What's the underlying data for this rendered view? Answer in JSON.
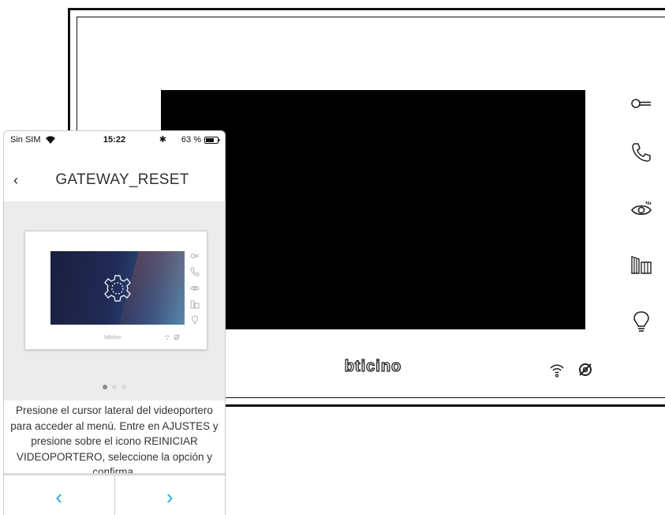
{
  "device": {
    "brand": "bticino",
    "side_buttons": [
      "key-icon",
      "phone-handset-icon",
      "eye-icon",
      "gates-icon",
      "bulb-icon"
    ],
    "status_icons": [
      "wifi-icon",
      "muted-ring-icon"
    ]
  },
  "app": {
    "status_bar": {
      "carrier": "Sin SIM",
      "time": "15:22",
      "bluetooth": "✱",
      "battery": "63 %"
    },
    "header": {
      "back_icon": "‹",
      "title": "GATEWAY_RESET"
    },
    "gallery": {
      "image_icon": "gear-icon",
      "page_count": 3,
      "active_page": 1
    },
    "instructions": "Presione el cursor lateral del videoportero para acceder al menú. Entre en AJUSTES y presione sobre el icono REINICIAR VIDEOPORTERO, seleccione la opción y confirma.",
    "footer": {
      "prev_label": "‹",
      "next_label": "›"
    },
    "colors": {
      "accent": "#1fa9e4",
      "gallery_bg": "#ececec"
    }
  }
}
